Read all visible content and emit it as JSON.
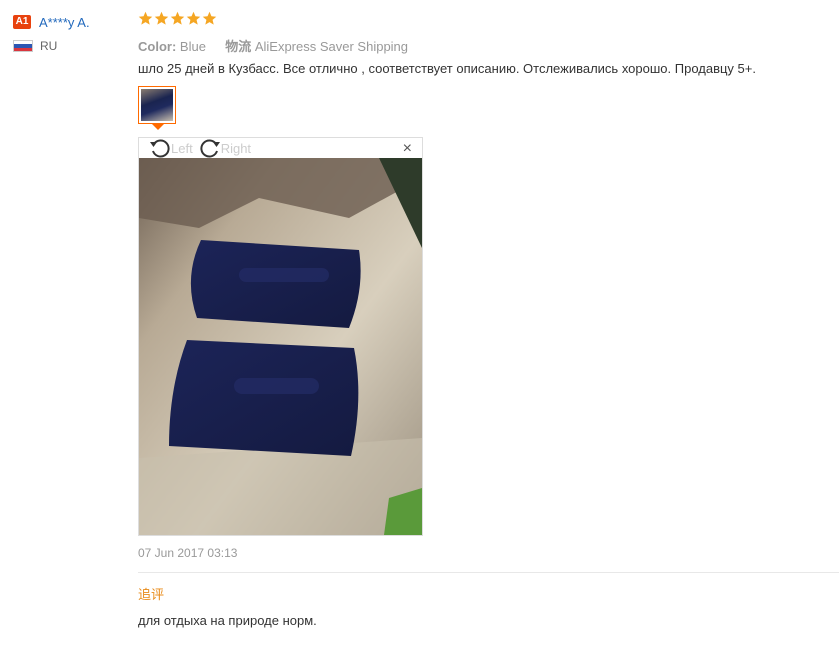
{
  "user": {
    "level": "A1",
    "name": "A****y A.",
    "country": "RU",
    "flag_colors": [
      "#ffffff",
      "#2c57b3",
      "#d9363e"
    ]
  },
  "review": {
    "stars": 5,
    "star_color": "#f5a623",
    "color_label": "Color:",
    "color_value": "Blue",
    "shipping_label": "物流",
    "shipping_value": "AliExpress Saver Shipping",
    "text": "шло 25 дней в Кузбасс. Все отлично , соответствует описанию. Отслеживались хорошо. Продавцу 5+.",
    "date": "07 Jun 2017 03:13"
  },
  "viewer": {
    "rotate_left": "Left",
    "rotate_right": "Right",
    "close": "×"
  },
  "append": {
    "title": "追评",
    "text": "для отдыха на природе норм."
  },
  "accent_color": "#ff6a00"
}
